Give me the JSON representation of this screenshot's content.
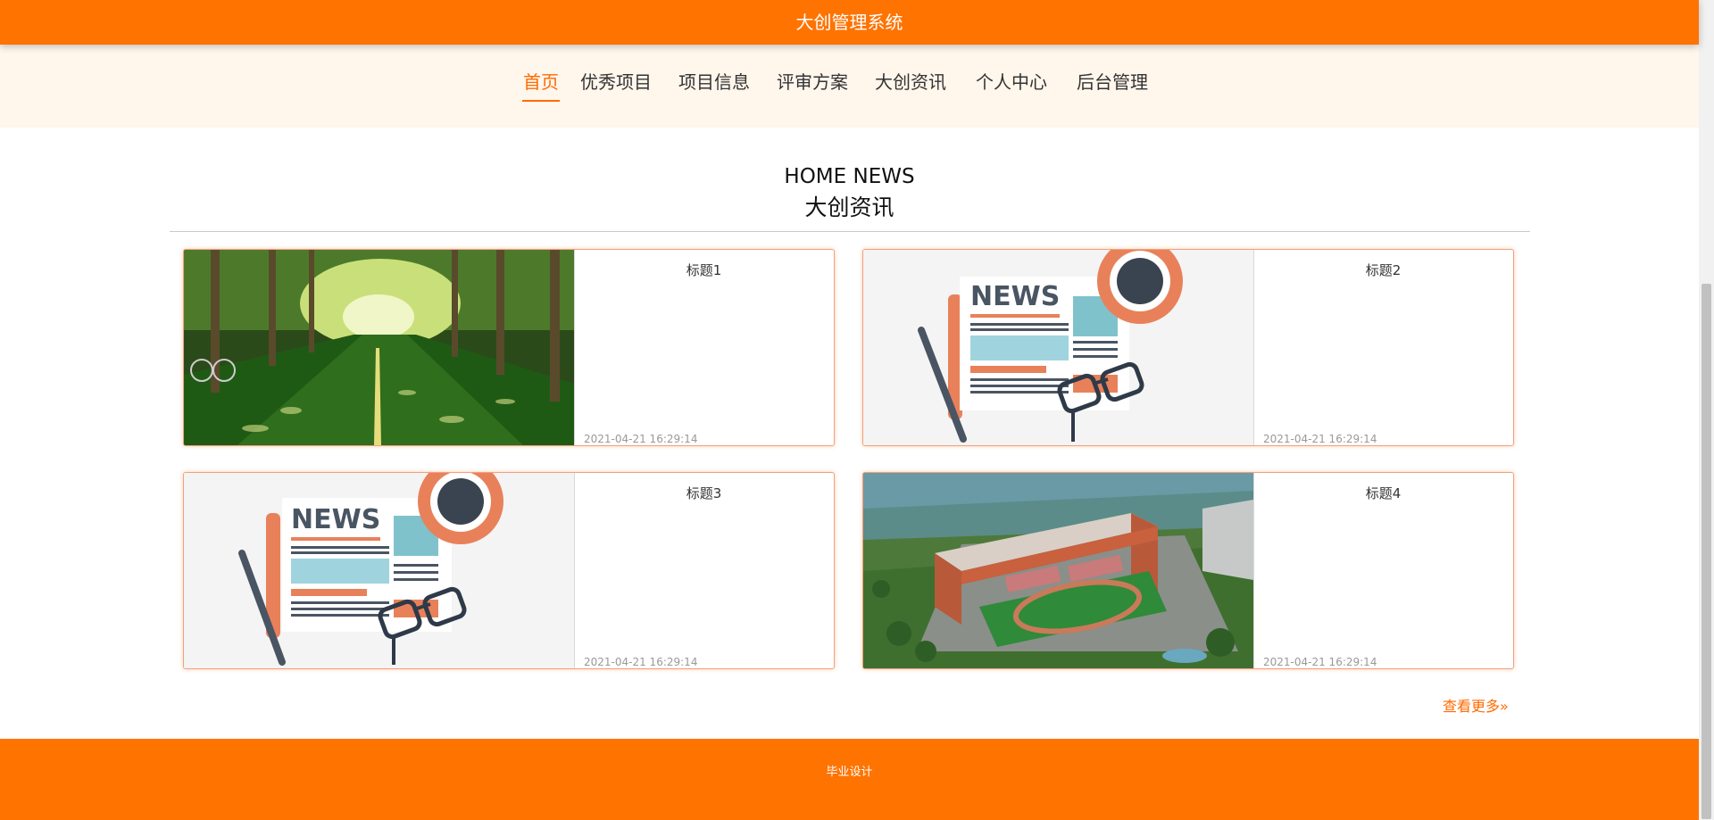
{
  "header": {
    "title": "大创管理系统"
  },
  "nav": {
    "items": [
      {
        "label": "首页",
        "active": true
      },
      {
        "label": "优秀项目"
      },
      {
        "label": "项目信息"
      },
      {
        "label": "评审方案"
      },
      {
        "label": "大创资讯"
      },
      {
        "label": "个人中心"
      },
      {
        "label": "后台管理"
      }
    ]
  },
  "section": {
    "title_en": "HOME NEWS",
    "title_cn": "大创资讯"
  },
  "news": [
    {
      "title": "标题1",
      "date": "2021-04-21 16:29:14",
      "image": "campus-tree-road-photo"
    },
    {
      "title": "标题2",
      "date": "2021-04-21 16:29:14",
      "image": "newspaper-illustration",
      "image_text": "NEWS"
    },
    {
      "title": "标题3",
      "date": "2021-04-21 16:29:14",
      "image": "newspaper-illustration",
      "image_text": "NEWS"
    },
    {
      "title": "标题4",
      "date": "2021-04-21 16:29:14",
      "image": "campus-aerial-photo"
    }
  ],
  "more_label": "查看更多»",
  "footer": {
    "text": "毕业设计"
  },
  "colors": {
    "brand": "#ff7300",
    "nav_bg": "#fff6ec",
    "active": "#ff6a00"
  }
}
